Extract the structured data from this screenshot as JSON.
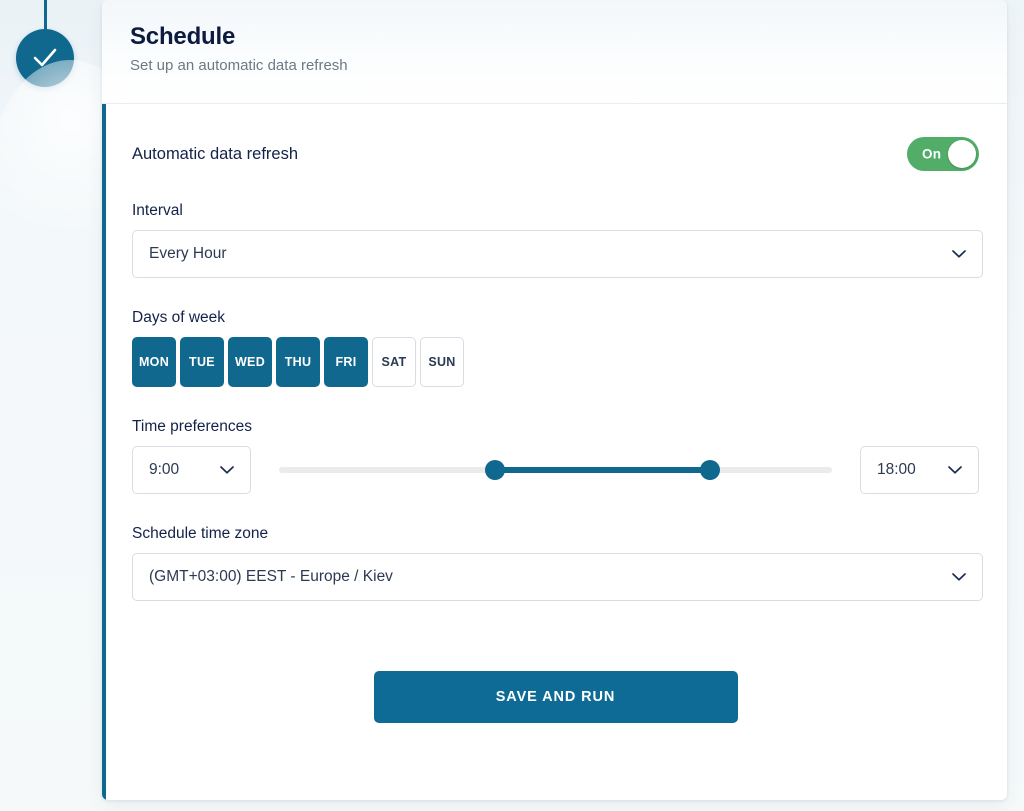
{
  "stepper": {
    "status_icon": "check-icon",
    "accent_color": "#10688f"
  },
  "card": {
    "title": "Schedule",
    "subtitle": "Set up an automatic data refresh"
  },
  "auto_refresh": {
    "label": "Automatic data refresh",
    "toggle_state": "On",
    "toggle_on_color": "#52ad68"
  },
  "interval": {
    "label": "Interval",
    "value": "Every Hour"
  },
  "days_of_week": {
    "label": "Days of week",
    "items": [
      {
        "label": "MON",
        "selected": true
      },
      {
        "label": "TUE",
        "selected": true
      },
      {
        "label": "WED",
        "selected": true
      },
      {
        "label": "THU",
        "selected": true
      },
      {
        "label": "FRI",
        "selected": true
      },
      {
        "label": "SAT",
        "selected": false
      },
      {
        "label": "SUN",
        "selected": false
      }
    ]
  },
  "time_preferences": {
    "label": "Time preferences",
    "start_value": "9:00",
    "end_value": "18:00",
    "slider": {
      "start_percent": 39,
      "end_percent": 78,
      "track_color": "#ebebeb",
      "range_color": "#10688f"
    }
  },
  "timezone": {
    "label": "Schedule time zone",
    "value": "(GMT+03:00) EEST - Europe / Kiev"
  },
  "actions": {
    "save_label": "SAVE AND RUN",
    "save_color": "#0e6b95"
  }
}
